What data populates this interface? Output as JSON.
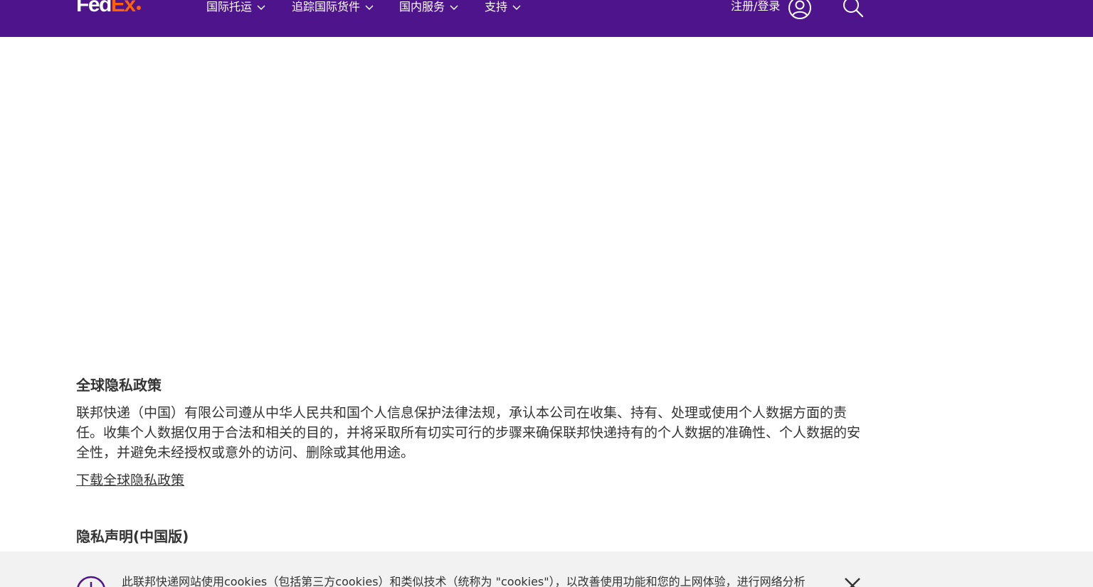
{
  "header": {
    "logo": {
      "part1": "Fed",
      "part2": "Ex",
      "brand_purple": "#4d148c",
      "brand_orange": "#ff6200"
    },
    "nav": [
      {
        "label": "国际托运"
      },
      {
        "label": "追踪国际货件"
      },
      {
        "label": "国内服务"
      },
      {
        "label": "支持"
      }
    ],
    "login_label": "注册/登录",
    "icons": {
      "user": "user-circle-icon",
      "search": "search-icon",
      "chevron": "chevron-down-icon"
    }
  },
  "main": {
    "global_privacy": {
      "title": "全球隐私政策",
      "body": "联邦快递（中国）有限公司遵从中华人民共和国个人信息保护法律法规，承认本公司在收集、持有、处理或使用个人数据方面的责任。收集个人数据仅用于合法和相关的目的，并将采取所有切实可行的步骤来确保联邦快递持有的个人数据的准确性、个人数据的安全性，并避免未经授权或意外的访问、删除或其他用途。",
      "download_link": "下载全球隐私政策"
    },
    "china_statement": {
      "title": "隐私声明(中国版)"
    }
  },
  "cookie_banner": {
    "text": "此联邦快递网站使用cookies（包括第三方cookies）和类似技术（统称为 \"cookies\"），以改善使用功能和您的上网体验，进行网络分析",
    "icons": {
      "info": "info-circle-icon",
      "close": "close-icon"
    }
  }
}
